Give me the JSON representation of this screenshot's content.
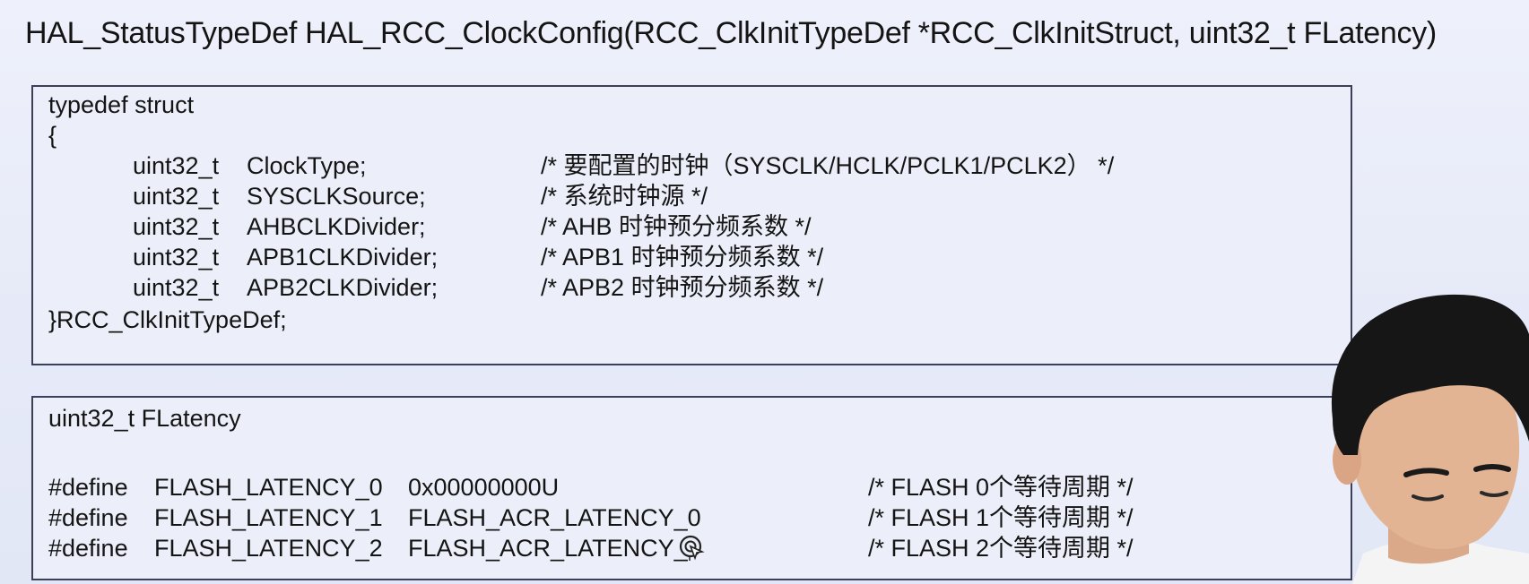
{
  "slide": {
    "title": "HAL_StatusTypeDef HAL_RCC_ClockConfig(RCC_ClkInitTypeDef  *RCC_ClkInitStruct, uint32_t FLatency)"
  },
  "struct_box": {
    "header": "typedef struct",
    "open_brace": "{",
    "fields": [
      {
        "type": "uint32_t",
        "name": "ClockType;",
        "comment": "/* 要配置的时钟（SYSCLK/HCLK/PCLK1/PCLK2） */"
      },
      {
        "type": "uint32_t",
        "name": "SYSCLKSource;",
        "comment": "/* 系统时钟源 */"
      },
      {
        "type": "uint32_t",
        "name": "AHBCLKDivider;",
        "comment": "/* AHB  时钟预分频系数 */"
      },
      {
        "type": "uint32_t",
        "name": "APB1CLKDivider;",
        "comment": "/* APB1 时钟预分频系数 */"
      },
      {
        "type": "uint32_t",
        "name": "APB2CLKDivider;",
        "comment": "/* APB2 时钟预分频系数 */"
      }
    ],
    "closing": "}RCC_ClkInitTypeDef;"
  },
  "latency_box": {
    "header": "uint32_t FLatency",
    "defines": [
      {
        "keyword": "#define",
        "name": "FLASH_LATENCY_0",
        "value": "0x00000000U",
        "comment": "/* FLASH 0个等待周期 */"
      },
      {
        "keyword": "#define",
        "name": "FLASH_LATENCY_1",
        "value": "FLASH_ACR_LATENCY_0",
        "comment": "/* FLASH 1个等待周期 */"
      },
      {
        "keyword": "#define",
        "name": "FLASH_LATENCY_2",
        "value": "FLASH_ACR_LATENCY_",
        "comment": "/* FLASH 2个等待周期 */"
      }
    ]
  },
  "colors": {
    "background": "#e9ecf8",
    "box_border": "#3b3f59",
    "text": "#141414"
  },
  "icons": {
    "cursor": "pointer-cursor-icon"
  }
}
